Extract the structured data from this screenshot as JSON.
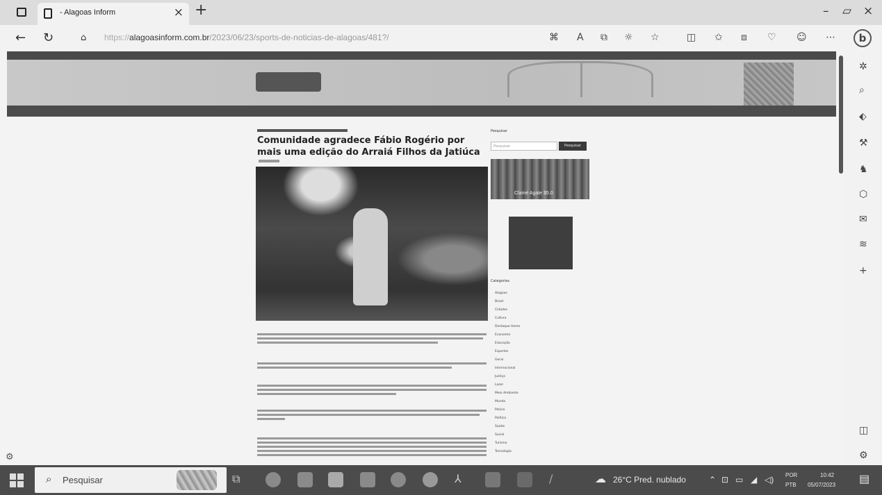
{
  "browser": {
    "tab_title": "- Alagoas Inform",
    "tab_close": "×",
    "new_tab": "+",
    "url_host": "alagoasinform.com.br",
    "url_rest": "/2023/06/23/sports-de-noticias-de-alagoas/481?/",
    "window_controls": {
      "minimize": "–",
      "maximize": "▱",
      "close": "×"
    }
  },
  "article": {
    "headline": "Comunidade agradece Fábio Rogério por mais uma edição do Arraiá Filhos da Jatiúca"
  },
  "sidebar": {
    "search_label": "Pesquisar",
    "search_placeholder": "Pesquisar",
    "search_button": "Pesquisar",
    "ad_caption": "Clamé Agate $5.0",
    "categories_label": "Categorias",
    "categories": [
      "Alagoas",
      "Brasil",
      "Cidades",
      "Cultura",
      "Destaque Home",
      "Economia",
      "Educação",
      "Esportes",
      "Geral",
      "Internacional",
      "Justiça",
      "Lazer",
      "Meio Ambiente",
      "Mundo",
      "Polícia",
      "Política",
      "Saúde",
      "Social",
      "Turismo",
      "Tecnologia"
    ]
  },
  "taskbar": {
    "search_placeholder": "Pesquisar",
    "weather": "26°C  Pred. nublado",
    "lang_top": "POR",
    "lang_bottom": "PTB",
    "time": "10:42",
    "date": "05/07/2023"
  }
}
